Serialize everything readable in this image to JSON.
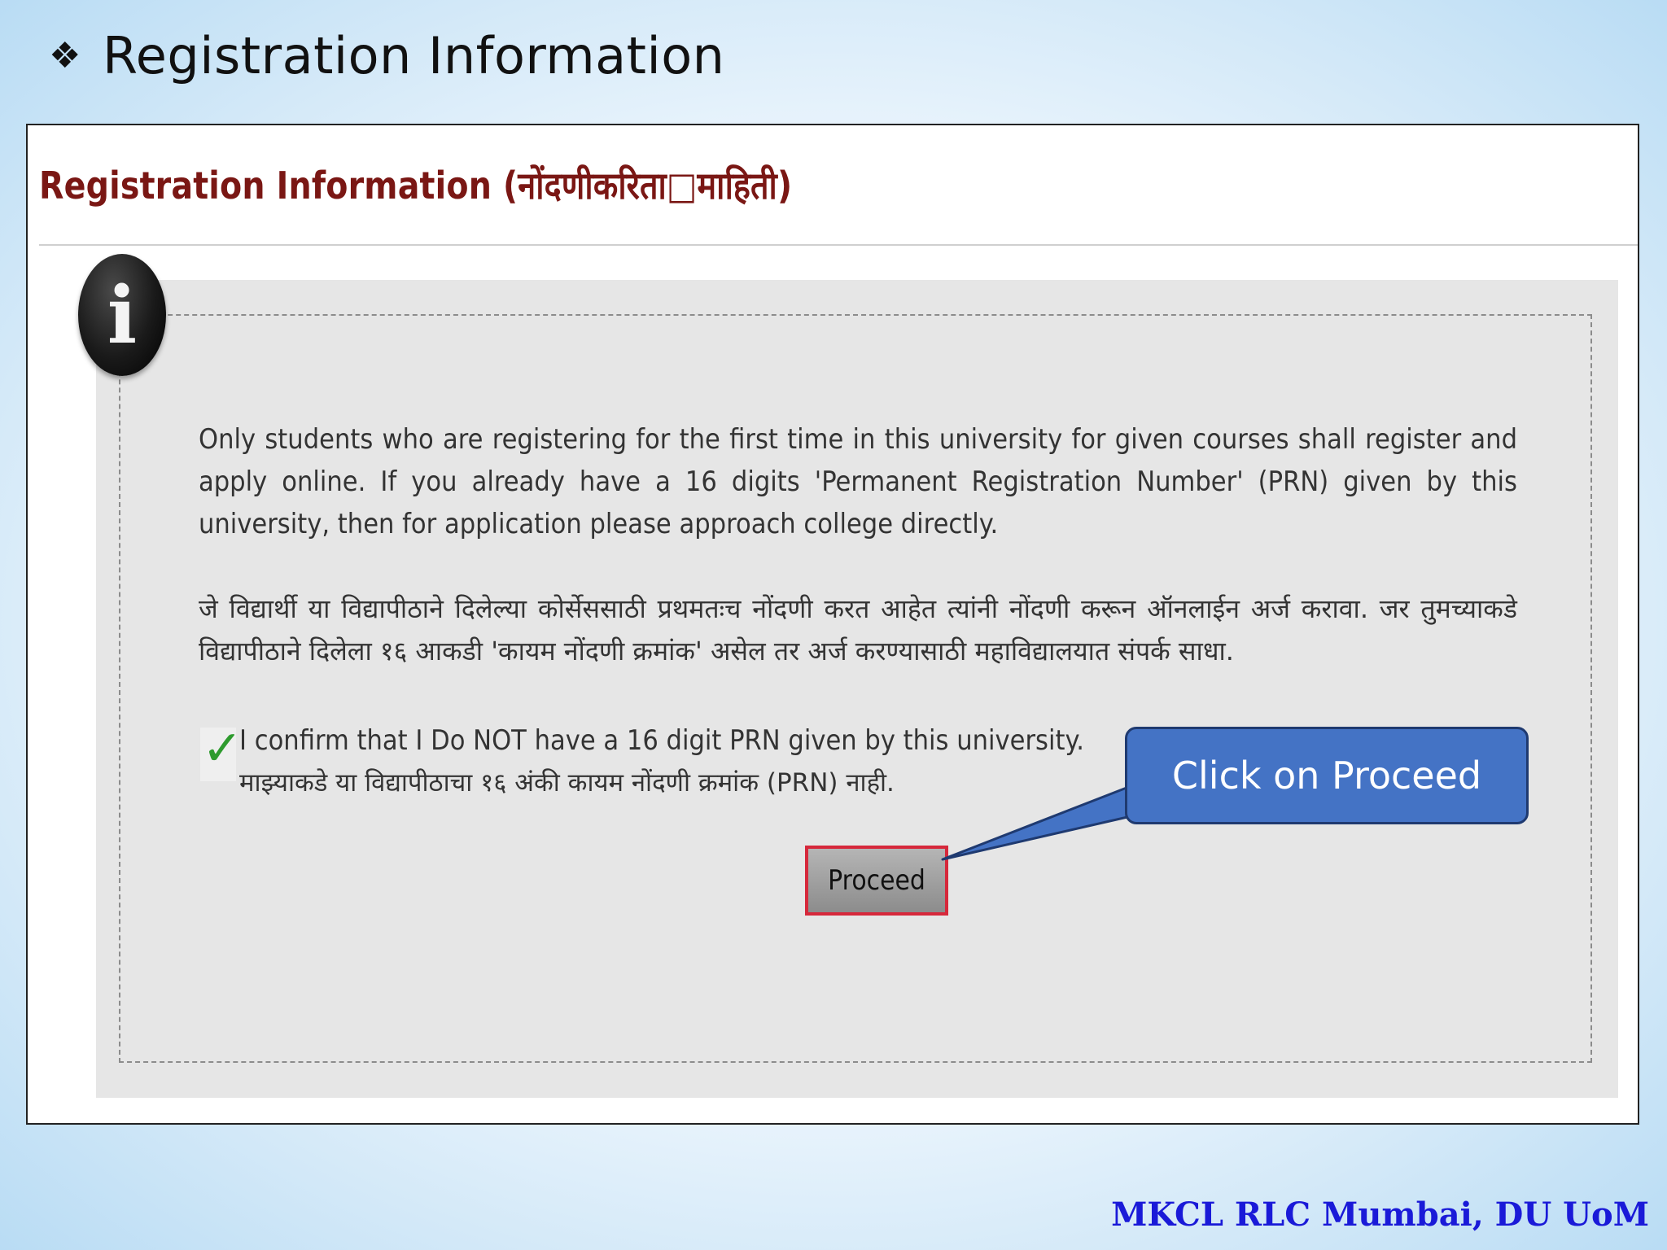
{
  "slide": {
    "bullet": "❖",
    "heading": "Registration Information",
    "footer": "MKCL RLC Mumbai, DU UoM"
  },
  "page": {
    "header": "Registration Information (नोंदणीकरिता□माहिती)",
    "info_icon": "i",
    "paragraph_en": "Only students who are registering for the first time in this university for given courses shall register and apply online. If you already have a 16 digits 'Permanent Registration Number' (PRN) given by this university, then for application please approach college directly.",
    "paragraph_mr": "जे विद्यार्थी या विद्यापीठाने दिलेल्या कोर्सेससाठी प्रथमतःच नोंदणी करत आहेत त्यांनी नोंदणी करून ऑनलाईन अर्ज करावा. जर तुमच्याकडे विद्यापीठाने दिलेला १६ आकडी 'कायम नोंदणी क्रमांक' असेल तर अर्ज करण्यासाठी महाविद्यालयात संपर्क साधा.",
    "confirm_en": "I confirm that I Do NOT have a 16 digit PRN given by this university.",
    "confirm_mr": "माझ्याकडे या विद्यापीठाचा १६ अंकी कायम नोंदणी क्रमांक (PRN) नाही.",
    "checkbox_checked": true,
    "proceed_label": "Proceed"
  },
  "callout": {
    "text": "Click on Proceed"
  },
  "colors": {
    "header": "#7a1714",
    "callout_fill": "#4473c5",
    "highlight_border": "#d6283b",
    "footer_text": "#1a1ad8",
    "check": "#2e9b2e"
  }
}
